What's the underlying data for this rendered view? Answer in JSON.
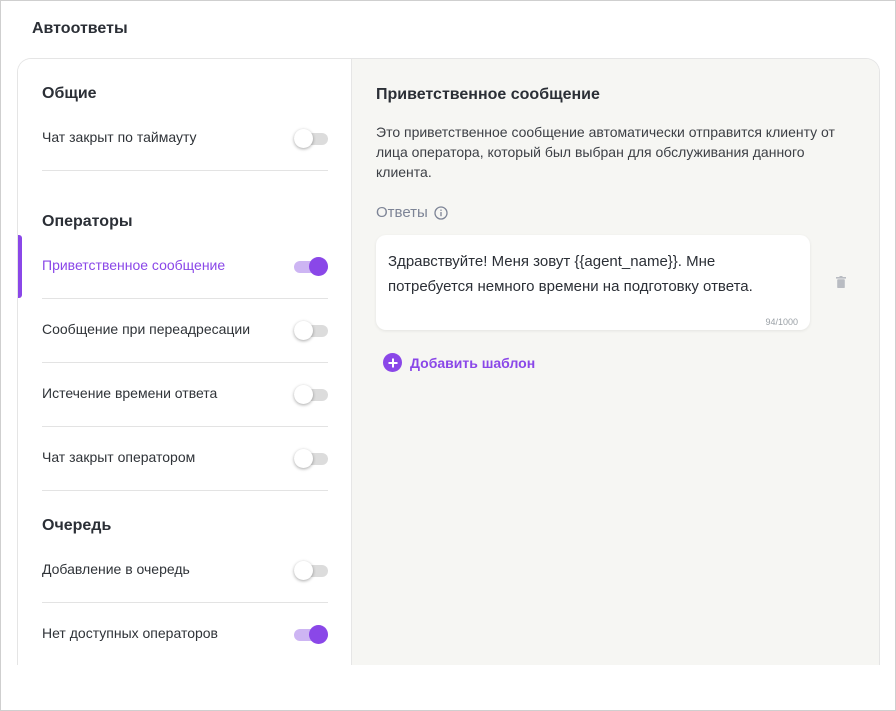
{
  "page": {
    "title": "Автоответы"
  },
  "colors": {
    "accent": "#8a47e8",
    "panel_bg": "#f6f6f3"
  },
  "sidebar": {
    "sections": [
      {
        "title": "Общие"
      },
      {
        "title": "Операторы"
      },
      {
        "title": "Очередь"
      }
    ],
    "items": [
      {
        "label": "Чат закрыт по таймауту",
        "enabled": false,
        "active": false
      },
      {
        "label": "Приветственное сообщение",
        "enabled": true,
        "active": true
      },
      {
        "label": "Сообщение при переадресации",
        "enabled": false,
        "active": false
      },
      {
        "label": "Истечение времени ответа",
        "enabled": false,
        "active": false
      },
      {
        "label": "Чат закрыт оператором",
        "enabled": false,
        "active": false
      },
      {
        "label": "Добавление в очередь",
        "enabled": false,
        "active": false
      },
      {
        "label": "Нет доступных операторов",
        "enabled": true,
        "active": false
      }
    ]
  },
  "detail": {
    "title": "Приветственное сообщение",
    "description": "Это приветственное сообщение автоматически отправится клиенту от лица оператора, который был выбран для обслуживания данного клиента.",
    "answers_label": "Ответы",
    "answers_icon": "info-icon",
    "reply": {
      "text": "Здравствуйте! Меня зовут {{agent_name}}. Мне потребуется немного времени на подготовку ответа.",
      "counter": "94/1000"
    },
    "delete_icon": "trash-icon",
    "add_template_label": "Добавить шаблон"
  }
}
